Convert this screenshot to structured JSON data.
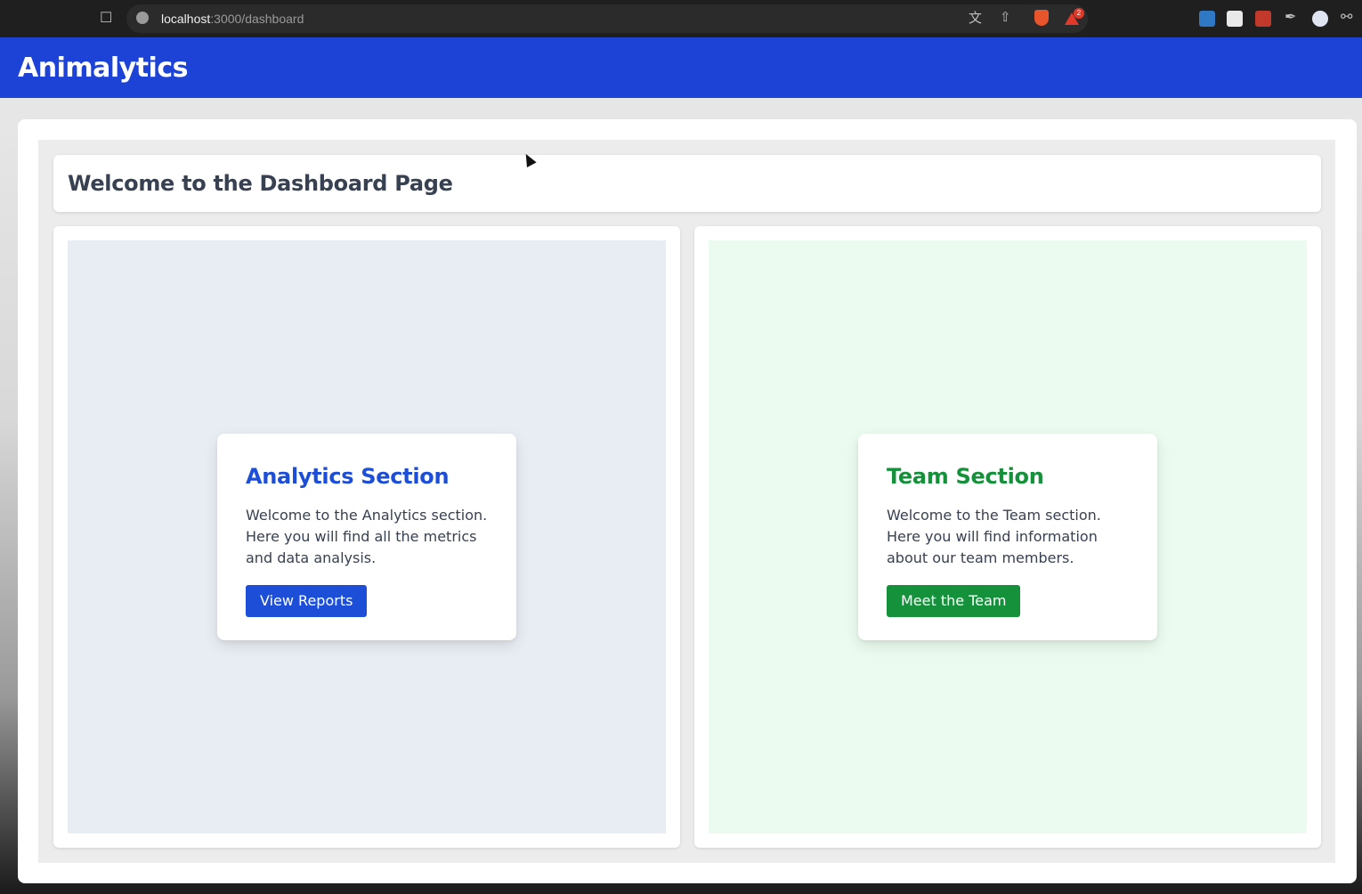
{
  "browser": {
    "url_host": "localhost",
    "url_path": ":3000/dashboard",
    "extension_badge": "2",
    "icons": [
      "bookmark-icon",
      "site-info-icon",
      "translate-icon",
      "share-icon",
      "brave-shield-icon",
      "rewards-icon",
      "extension-icon",
      "puzzle-icon"
    ]
  },
  "header": {
    "brand": "Animalytics",
    "background_color": "#1d42d6"
  },
  "welcome": {
    "title": "Welcome to the Dashboard Page"
  },
  "sections": {
    "analytics": {
      "title": "Analytics Section",
      "body": "Welcome to the Analytics section. Here you will find all the metrics and data analysis.",
      "button": "View Reports",
      "accent_color": "#1d4ed8"
    },
    "team": {
      "title": "Team Section",
      "body": "Welcome to the Team section. Here you will find information about our team members.",
      "button": "Meet the Team",
      "accent_color": "#16913b"
    }
  }
}
